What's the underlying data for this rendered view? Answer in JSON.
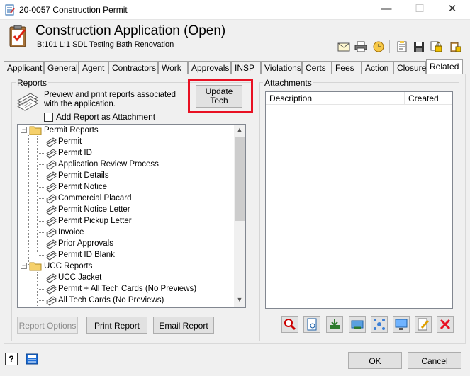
{
  "window": {
    "title": "20-0057 Construction Permit",
    "minimize": "—",
    "maximize": "☐",
    "close": "✕"
  },
  "header": {
    "title": "Construction Application (Open)",
    "subtitle": "B:101 L:1  SDL Testing Bath Renovation"
  },
  "tabs": [
    "Applicant",
    "General",
    "Agent",
    "Contractors",
    "Work",
    "Approvals",
    "INSP",
    "Violations",
    "Certs",
    "Fees",
    "Action",
    "Closure",
    "Related"
  ],
  "active_tab": "Related",
  "reports": {
    "group_label": "Reports",
    "description": "Preview and print reports associated with the application.",
    "update_button": "Update Tech",
    "add_attachment_label": "Add Report as Attachment",
    "tree": [
      {
        "kind": "folder",
        "label": "Permit Reports",
        "expander": "−"
      },
      {
        "kind": "item",
        "label": "Permit"
      },
      {
        "kind": "item",
        "label": "Permit ID"
      },
      {
        "kind": "item",
        "label": "Application Review Process"
      },
      {
        "kind": "item",
        "label": "Permit Details"
      },
      {
        "kind": "item",
        "label": "Permit Notice"
      },
      {
        "kind": "item",
        "label": "Commercial Placard"
      },
      {
        "kind": "item",
        "label": "Permit Notice Letter"
      },
      {
        "kind": "item",
        "label": "Permit Pickup Letter"
      },
      {
        "kind": "item",
        "label": "Invoice"
      },
      {
        "kind": "item",
        "label": "Prior Approvals"
      },
      {
        "kind": "item",
        "label": "Permit ID Blank"
      },
      {
        "kind": "folder",
        "label": "UCC Reports",
        "expander": "−"
      },
      {
        "kind": "item",
        "label": "UCC Jacket"
      },
      {
        "kind": "item",
        "label": "Permit + All Tech Cards (No Previews)"
      },
      {
        "kind": "item",
        "label": "All Tech Cards (No Previews)"
      }
    ],
    "buttons": {
      "report_options": "Report Options",
      "print_report": "Print Report",
      "email_report": "Email Report"
    }
  },
  "attachments": {
    "group_label": "Attachments",
    "columns": [
      "Description",
      "Created"
    ]
  },
  "footer": {
    "ok": "OK",
    "cancel": "Cancel"
  },
  "colors": {
    "highlight_box": "#e81123",
    "folder": "#f5d06b",
    "accent_close": "#e81123"
  }
}
